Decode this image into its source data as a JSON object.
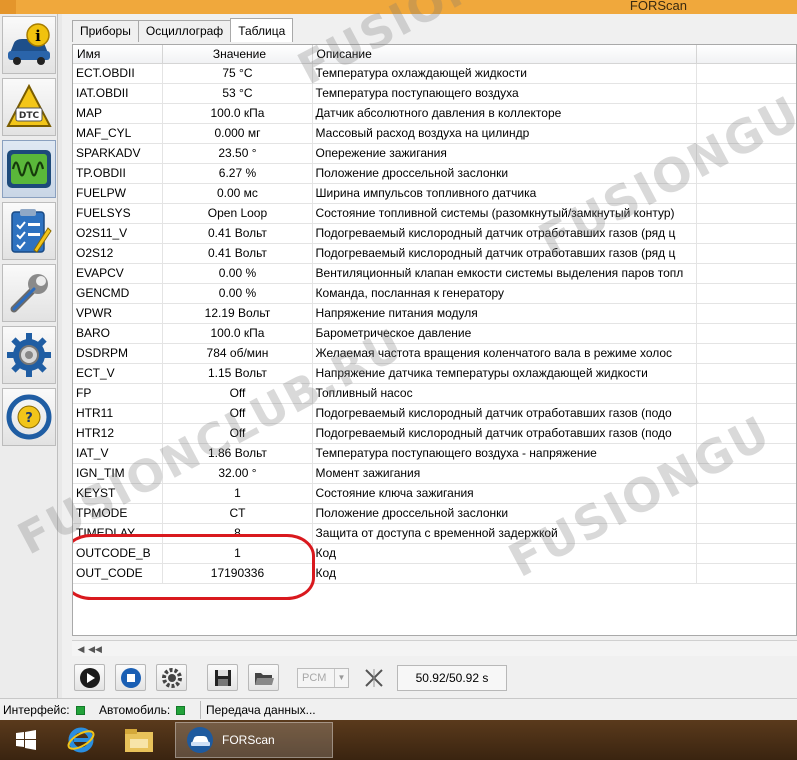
{
  "window": {
    "title": "FORScan"
  },
  "tabs": [
    {
      "label": "Приборы",
      "active": false
    },
    {
      "label": "Осциллограф",
      "active": false
    },
    {
      "label": "Таблица",
      "active": true
    }
  ],
  "table": {
    "headers": {
      "name": "Имя",
      "value": "Значение",
      "description": "Описание"
    },
    "rows": [
      {
        "name": "ECT.OBDII",
        "value": "75 °C",
        "description": "Температура охлаждающей жидкости"
      },
      {
        "name": "IAT.OBDII",
        "value": "53 °C",
        "description": "Температура поступающего воздуха"
      },
      {
        "name": "MAP",
        "value": "100.0 кПа",
        "description": "Датчик абсолютного давления в коллекторе"
      },
      {
        "name": "MAF_CYL",
        "value": "0.000 мг",
        "description": "Массовый расход воздуха на цилиндр"
      },
      {
        "name": "SPARKADV",
        "value": "23.50 °",
        "description": "Опережение зажигания"
      },
      {
        "name": "TP.OBDII",
        "value": "6.27 %",
        "description": "Положение дроссельной заслонки"
      },
      {
        "name": "FUELPW",
        "value": "0.00 мс",
        "description": "Ширина импульсов топливного датчика"
      },
      {
        "name": "FUELSYS",
        "value": "Open Loop",
        "description": "Состояние топливной системы (разомкнутый/замкнутый контур)"
      },
      {
        "name": "O2S11_V",
        "value": "0.41 Вольт",
        "description": "Подогреваемый кислородный датчик отработавших газов (ряд ц"
      },
      {
        "name": "O2S12",
        "value": "0.41 Вольт",
        "description": "Подогреваемый кислородный датчик отработавших газов (ряд ц"
      },
      {
        "name": "EVAPCV",
        "value": "0.00 %",
        "description": "Вентиляционный клапан емкости системы выделения паров топл"
      },
      {
        "name": "GENCMD",
        "value": "0.00 %",
        "description": "Команда, посланная к генератору"
      },
      {
        "name": "VPWR",
        "value": "12.19 Вольт",
        "description": "Напряжение питания модуля"
      },
      {
        "name": "BARO",
        "value": "100.0 кПа",
        "description": "Барометрическое давление"
      },
      {
        "name": "DSDRPM",
        "value": "784 об/мин",
        "description": "Желаемая частота вращения коленчатого вала в режиме холос"
      },
      {
        "name": "ECT_V",
        "value": "1.15 Вольт",
        "description": "Напряжение датчика температуры охлаждающей жидкости"
      },
      {
        "name": "FP",
        "value": "Off",
        "description": "Топливный насос"
      },
      {
        "name": "HTR11",
        "value": "Off",
        "description": "Подогреваемый кислородный датчик отработавших газов (подо"
      },
      {
        "name": "HTR12",
        "value": "Off",
        "description": "Подогреваемый кислородный датчик отработавших газов (подо"
      },
      {
        "name": "IAT_V",
        "value": "1.86 Вольт",
        "description": "Температура поступающего воздуха - напряжение"
      },
      {
        "name": "IGN_TIM",
        "value": "32.00 °",
        "description": "Момент зажигания"
      },
      {
        "name": "KEYST",
        "value": "1",
        "description": "Состояние ключа зажигания"
      },
      {
        "name": "TPMODE",
        "value": "CT",
        "description": "Положение дроссельной заслонки"
      },
      {
        "name": "TIMEDLAY",
        "value": "8",
        "description": "Защита от доступа с временной задержкой"
      },
      {
        "name": "OUTCODE_B",
        "value": "1",
        "description": "Код"
      },
      {
        "name": "OUT_CODE",
        "value": "17190336",
        "description": "Код"
      }
    ]
  },
  "toolbar": {
    "pcm_label": "PCM",
    "time": "50.92/50.92 s"
  },
  "statusbar": {
    "interface_label": "Интерфейс:",
    "car_label": "Автомобиль:",
    "transfer_label": "Передача данных..."
  },
  "taskbar": {
    "app_label": "FORScan"
  },
  "watermark": {
    "text1": "FUSIONCLUB.RU",
    "text2": "FUSIONGU"
  },
  "colors": {
    "titlebar": "#f0a83c",
    "highlight": "#d9191e",
    "status_ok": "#22a33a",
    "taskbar": "#4a2f16"
  },
  "icons": [
    "info-icon",
    "dtc-icon",
    "oscilloscope-icon",
    "checklist-icon",
    "wrench-icon",
    "settings-gear-icon",
    "help-wheel-icon"
  ]
}
